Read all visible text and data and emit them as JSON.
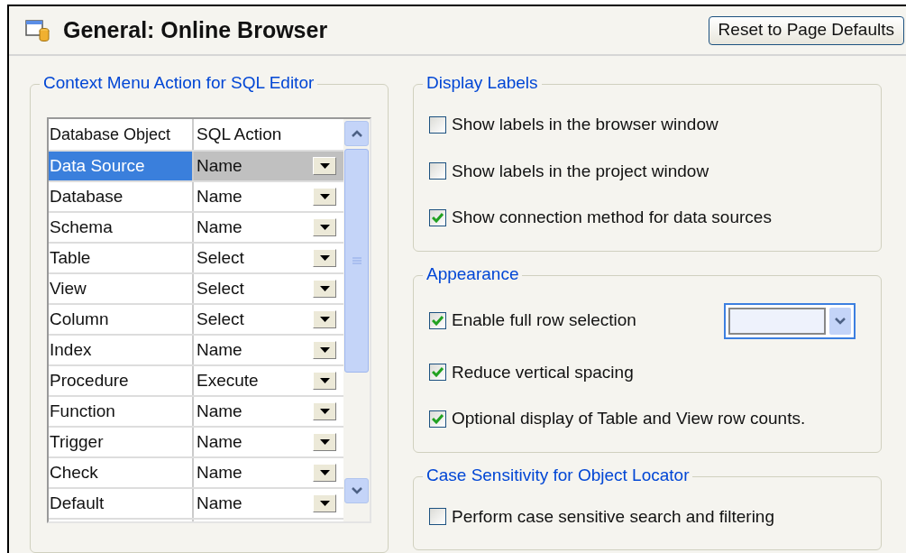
{
  "header": {
    "title": "General: Online Browser",
    "reset_button": "Reset to Page Defaults"
  },
  "context_menu": {
    "title": "Context Menu Action for SQL Editor",
    "columns": [
      "Database Object",
      "SQL Action"
    ],
    "rows": [
      {
        "object": "Data Source",
        "action": "Name",
        "selected": true
      },
      {
        "object": "Database",
        "action": "Name",
        "selected": false
      },
      {
        "object": "Schema",
        "action": "Name",
        "selected": false
      },
      {
        "object": "Table",
        "action": "Select",
        "selected": false
      },
      {
        "object": "View",
        "action": "Select",
        "selected": false
      },
      {
        "object": "Column",
        "action": "Select",
        "selected": false
      },
      {
        "object": "Index",
        "action": "Name",
        "selected": false
      },
      {
        "object": "Procedure",
        "action": "Execute",
        "selected": false
      },
      {
        "object": "Function",
        "action": "Name",
        "selected": false
      },
      {
        "object": "Trigger",
        "action": "Name",
        "selected": false
      },
      {
        "object": "Check",
        "action": "Name",
        "selected": false
      },
      {
        "object": "Default",
        "action": "Name",
        "selected": false
      }
    ]
  },
  "option_groups": [
    {
      "title": "Display Labels",
      "options": [
        {
          "kind": "checkbox",
          "label": "Show labels in the browser window",
          "checked": false
        },
        {
          "kind": "checkbox",
          "label": "Show labels in the project window",
          "checked": false
        },
        {
          "kind": "checkbox",
          "label": "Show connection method for data sources",
          "checked": true
        }
      ]
    },
    {
      "title": "Appearance",
      "options": [
        {
          "kind": "color",
          "label": "Enable full row selection",
          "checked": true
        },
        {
          "kind": "checkbox",
          "label": "Reduce vertical spacing",
          "checked": true
        },
        {
          "kind": "checkbox",
          "label": "Optional display of Table and View row counts.",
          "checked": true
        }
      ]
    },
    {
      "title": "Case Sensitivity for Object Locator",
      "options": [
        {
          "kind": "checkbox",
          "label": "Perform case sensitive search and filtering",
          "checked": false
        }
      ]
    }
  ]
}
